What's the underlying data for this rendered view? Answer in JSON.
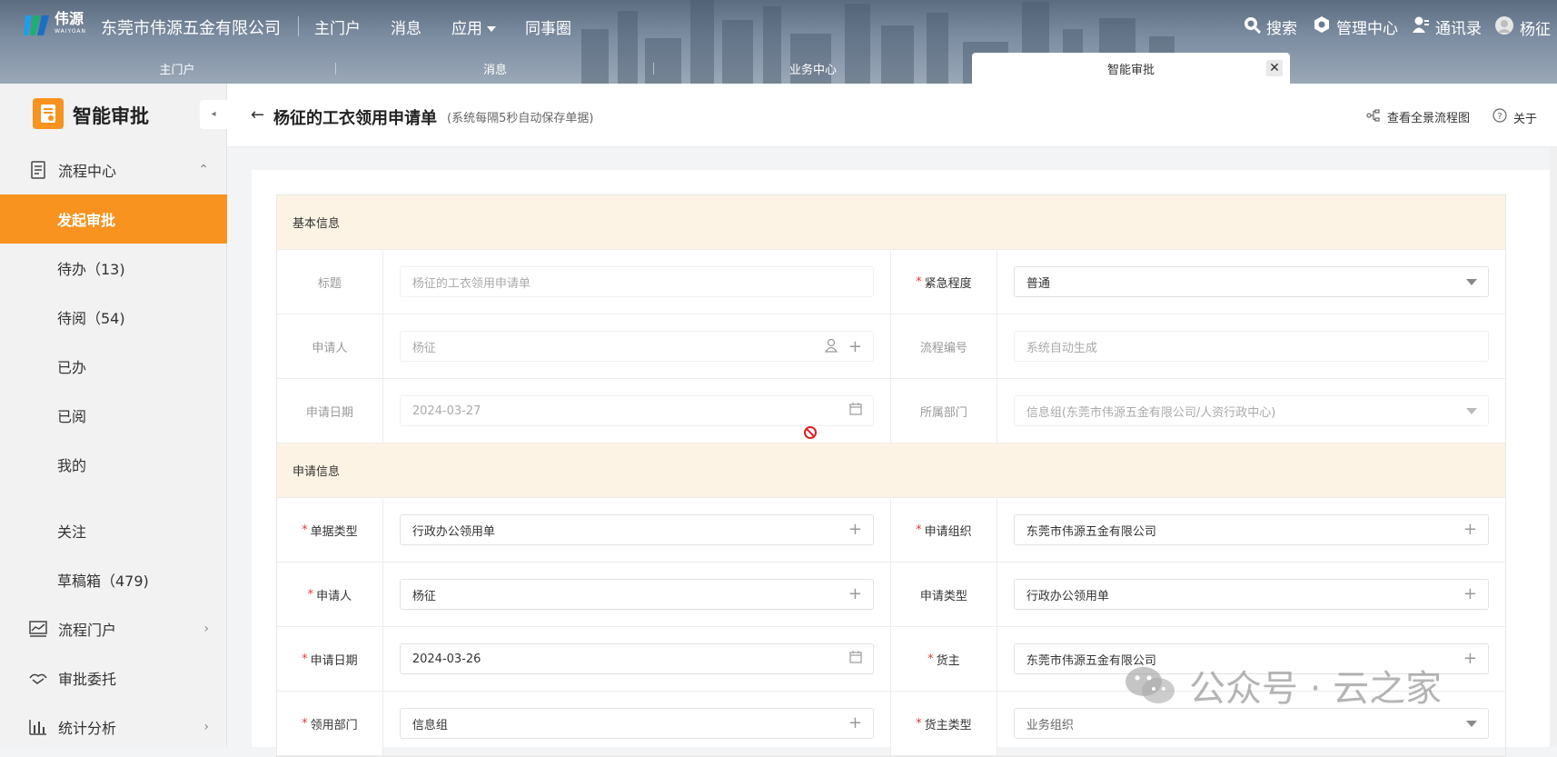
{
  "topbar": {
    "brand_cn": "伟源",
    "brand_en": "WAIYOAN",
    "company": "东莞市伟源五金有限公司",
    "menu": [
      "主门户",
      "消息",
      "应用",
      "同事圈"
    ],
    "search": "搜索",
    "admin": "管理中心",
    "contacts": "通讯录",
    "user": "杨征"
  },
  "tabs": [
    {
      "label": "主门户"
    },
    {
      "label": "消息"
    },
    {
      "label": "业务中心"
    },
    {
      "label": "智能审批",
      "close": "✕"
    }
  ],
  "sidebar": {
    "app_title": "智能审批",
    "process_center": "流程中心",
    "items": [
      "发起审批",
      "待办（13)",
      "待阅（54)",
      "已办",
      "已阅",
      "我的",
      "关注",
      "草稿箱（479)"
    ],
    "portal": "流程门户",
    "delegate": "审批委托",
    "stats": "统计分析"
  },
  "header": {
    "title": "杨征的工衣领用申请单",
    "subtitle": "(系统每隔5秒自动保存单据)",
    "flow_link": "查看全景流程图",
    "about": "关于"
  },
  "form": {
    "section_basic": "基本信息",
    "title_label": "标题",
    "title_value": "杨征的工衣领用申请单",
    "urgency_label": "紧急程度",
    "urgency_value": "普通",
    "applicant_label": "申请人",
    "applicant_value": "杨征",
    "flow_no_label": "流程编号",
    "flow_no_value": "系统自动生成",
    "apply_date_label": "申请日期",
    "apply_date_value": "2024-03-27",
    "dept_label": "所属部门",
    "dept_value": "信息组(东莞市伟源五金有限公司/人资行政中心)",
    "section_apply": "申请信息",
    "doc_type_label": "单据类型",
    "doc_type_value": "行政办公领用单",
    "org_label": "申请组织",
    "org_value": "东莞市伟源五金有限公司",
    "applicant2_label": "申请人",
    "applicant2_value": "杨征",
    "apply_type_label": "申请类型",
    "apply_type_value": "行政办公领用单",
    "date2_label": "申请日期",
    "date2_value": "2024-03-26",
    "owner_label": "货主",
    "owner_value": "东莞市伟源五金有限公司",
    "receive_dept_label": "领用部门",
    "receive_dept_value": "信息组",
    "owner_type_label": "货主类型",
    "owner_type_value": "业务组织"
  },
  "watermark": "公众号 · 云之家",
  "colors": {
    "accent": "#f7931e",
    "section_bg": "#fdf3e4",
    "required": "#e4393c"
  }
}
